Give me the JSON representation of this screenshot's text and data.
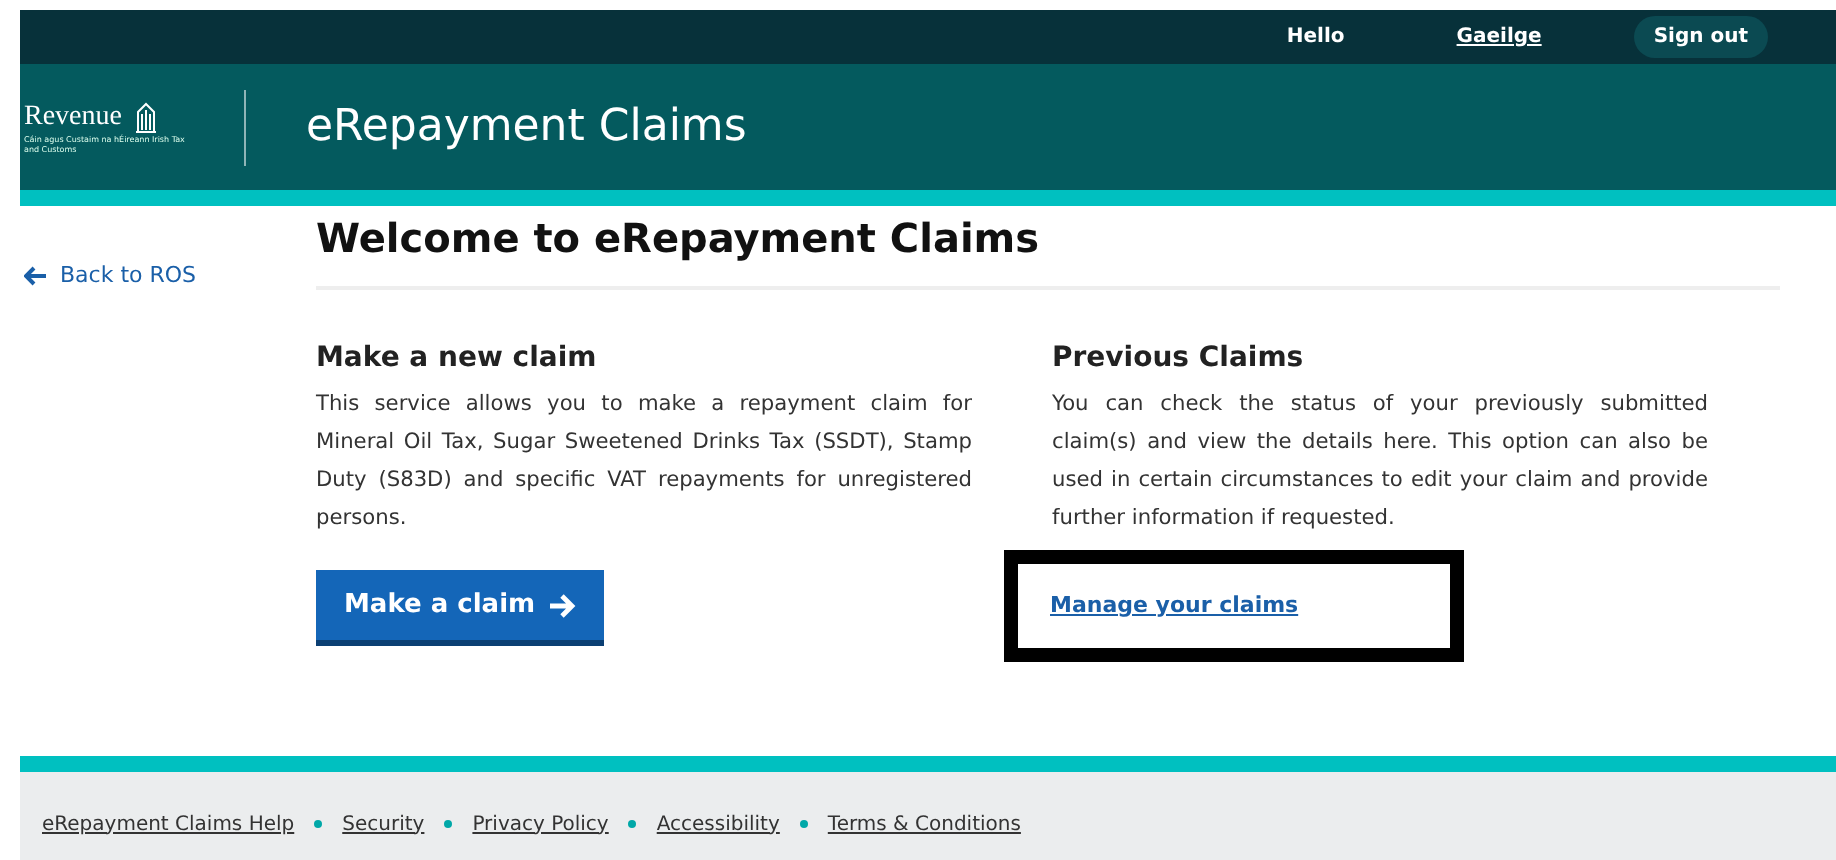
{
  "top_bar": {
    "greeting": "Hello",
    "language_link": "Gaeilge",
    "sign_out": "Sign out"
  },
  "header": {
    "logo_text": "Revenue",
    "logo_subtitle": "Cáin agus Custaim na hÉireann Irish Tax and Customs",
    "title": "eRepayment Claims"
  },
  "back_link": "Back to ROS",
  "page_title": "Welcome to eRepayment Claims",
  "sections": [
    {
      "heading": "Make a new claim",
      "body": "This service allows you to make a repayment claim for Mineral Oil Tax, Sugar Sweetened Drinks Tax (SSDT), Stamp Duty (S83D) and specific VAT repayments for unregistered persons.",
      "action": {
        "kind": "button",
        "label": "Make a claim"
      }
    },
    {
      "heading": "Previous Claims",
      "body": "You can check the status of your previously submitted claim(s) and view the details here. This option can also be used in certain circumstances to edit your claim and provide further information if requested.",
      "action": {
        "kind": "link",
        "label": "Manage your claims"
      }
    }
  ],
  "footer_links": [
    "eRepayment Claims Help",
    "Security",
    "Privacy Policy",
    "Accessibility",
    "Terms & Conditions"
  ]
}
